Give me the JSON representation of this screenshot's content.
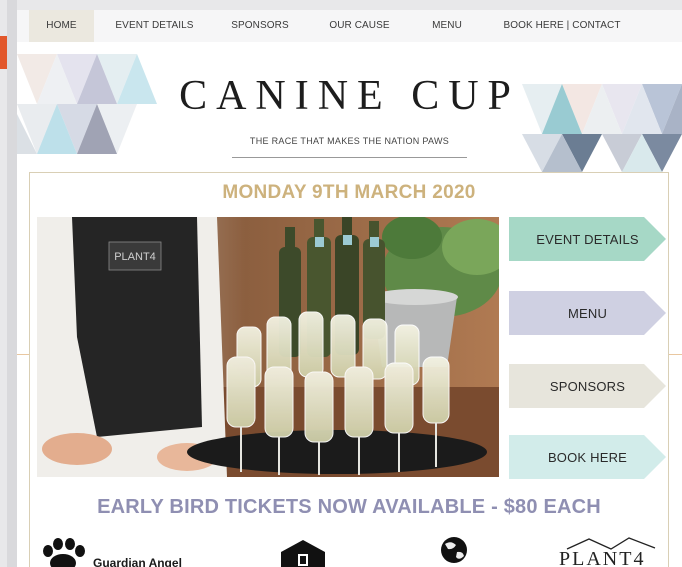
{
  "nav": {
    "items": [
      {
        "label": "HOME",
        "active": true
      },
      {
        "label": "EVENT DETAILS",
        "active": false
      },
      {
        "label": "SPONSORS",
        "active": false
      },
      {
        "label": "OUR CAUSE",
        "active": false
      },
      {
        "label": "MENU",
        "active": false
      },
      {
        "label": "BOOK HERE | CONTACT",
        "active": false
      }
    ]
  },
  "header": {
    "title": "CANINE CUP",
    "tagline": "THE RACE THAT MAKES THE NATION PAWS"
  },
  "main": {
    "date": "MONDAY 9TH MARCH 2020",
    "apron_logo": "PLANT4",
    "cta_buttons": [
      {
        "label": "EVENT DETAILS",
        "color": "#a6d8c6"
      },
      {
        "label": "MENU",
        "color": "#cfd0e2"
      },
      {
        "label": "SPONSORS",
        "color": "#e7e5dc"
      },
      {
        "label": "BOOK HERE",
        "color": "#d2ecea"
      }
    ],
    "tickets": "EARLY BIRD TICKETS NOW AVAILABLE - $80 EACH"
  },
  "sponsors": {
    "guardian_angel": "Guardian Angel",
    "plant4": "PLANT4"
  },
  "colors": {
    "accent_gold": "#cdb27d",
    "accent_lavender": "#8f8fb2",
    "brand_orange": "#e2572b"
  }
}
